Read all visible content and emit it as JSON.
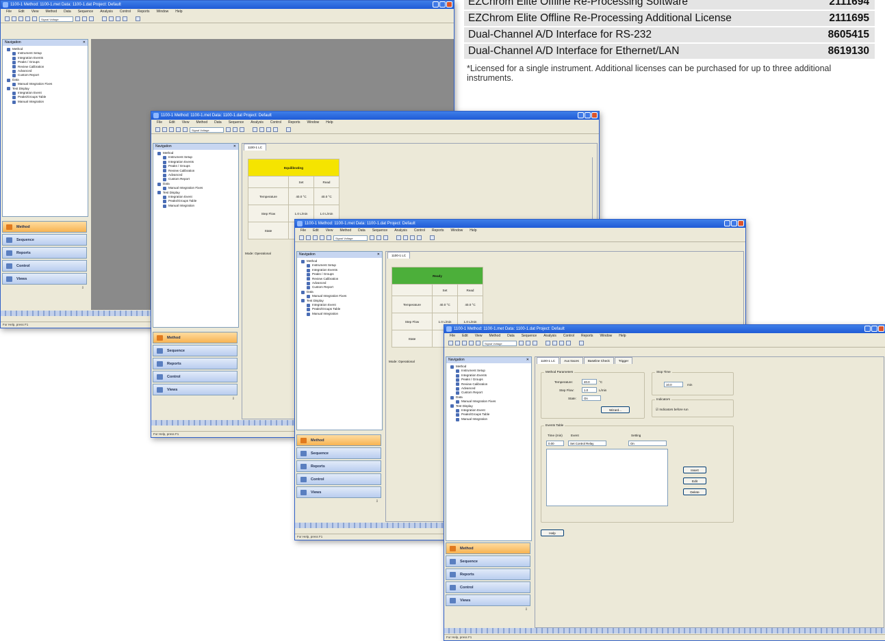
{
  "license_table": {
    "rows": [
      {
        "desc": "EZChrom Elite Offline Re-Processing Software",
        "pn": "2111694"
      },
      {
        "desc": "EZChrom Elite Offline Re-Processing Additional License",
        "pn": "2111695"
      },
      {
        "desc": "Dual-Channel A/D Interface for RS-232",
        "pn": "8605415"
      },
      {
        "desc": "Dual-Channel A/D Interface for Ethernet/LAN",
        "pn": "8619130"
      }
    ],
    "footnote": "*Licensed for a single instrument. Additional licenses can be purchased for up to three additional instruments."
  },
  "app": {
    "title": "1100-1   Method: 1100-1.met   Data: 1100-1.dat   Project: Default",
    "menu": [
      "File",
      "Edit",
      "View",
      "Method",
      "Data",
      "Sequence",
      "Analysis",
      "Control",
      "Reports",
      "Window",
      "Help"
    ],
    "signal_select": "Signal Voltage",
    "status_text": "For Help, press F1",
    "nav_title": "Navigation",
    "tree": [
      {
        "label": "Method",
        "level": 1
      },
      {
        "label": "Instrument Setup",
        "level": 2
      },
      {
        "label": "Integration Events",
        "level": 2
      },
      {
        "label": "Peaks / Groups",
        "level": 2
      },
      {
        "label": "Review Calibration",
        "level": 2
      },
      {
        "label": "Advanced",
        "level": 2
      },
      {
        "label": "Custom Report",
        "level": 2
      },
      {
        "label": "Data",
        "level": 1
      },
      {
        "label": "Manual Integration Fixes",
        "level": 2
      },
      {
        "label": "Test Display",
        "level": 1
      },
      {
        "label": "Integration Event",
        "level": 2
      },
      {
        "label": "Peaks/Groups Table",
        "level": 2
      },
      {
        "label": "Manual Integration",
        "level": 2
      }
    ],
    "nav_buttons": [
      "Method",
      "Sequence",
      "Reports",
      "Control",
      "Views"
    ],
    "colors": {
      "accent_orange": "#f7b352",
      "equilibrating": "#f5e400",
      "ready": "#4caf3a"
    }
  },
  "status_panels": {
    "tab": "1100-1 LC",
    "col_set": "Set",
    "col_read": "Read",
    "row_temp": "Temperature",
    "row_flow": "Step Flow",
    "row_state": "State",
    "footer": "Mode: Operational",
    "panel1": {
      "state": "Equilibrating",
      "temp_set": "40.0 °C",
      "temp_read": "40.0 °C",
      "flow_set": "1.0 L/min",
      "flow_read": "1.0 L/min"
    },
    "panel2": {
      "state": "Ready",
      "temp_set": "40.0 °C",
      "temp_read": "40.0 °C",
      "flow_set": "1.0 L/min",
      "flow_read": "1.0 L/min"
    }
  },
  "setup": {
    "tabs": [
      "1100-1 LC",
      "Aux traces",
      "Baseline Check",
      "Trigger"
    ],
    "method_params": "Method Parameters",
    "temp_label": "Temperature:",
    "temp_value": "40.0",
    "temp_unit": "°C",
    "flow_label": "Step Flow:",
    "flow_value": "1.0",
    "flow_unit": "L/min",
    "state_label": "State:",
    "state_value": "On",
    "wizard": "Wizard...",
    "stop_time": "Stop Time",
    "stop_value": "10.0",
    "stop_unit": "min",
    "indicators": "Indicators",
    "indicator_check": "Indicators before run",
    "events_table": "Events Table",
    "col_time": "Time (min)",
    "col_event": "Event",
    "col_setting": "Setting",
    "ev_time": "0.00",
    "ev_event": "Set Control Relay",
    "ev_setting": "On",
    "btn_insert": "Insert",
    "btn_edit": "Edit",
    "btn_delete": "Delete",
    "btn_help": "Help"
  }
}
